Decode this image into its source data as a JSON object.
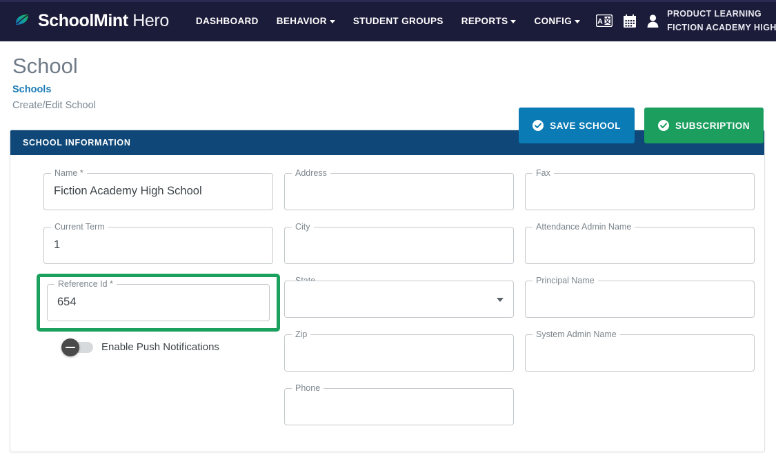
{
  "nav": {
    "brand_bold": "SchoolMint",
    "brand_light": "Hero",
    "brand_icon": "leaf-logo-icon",
    "items": [
      {
        "label": "DASHBOARD",
        "has_caret": false,
        "name": "nav-dashboard"
      },
      {
        "label": "BEHAVIOR",
        "has_caret": true,
        "name": "nav-behavior"
      },
      {
        "label": "STUDENT GROUPS",
        "has_caret": false,
        "name": "nav-student-groups"
      },
      {
        "label": "REPORTS",
        "has_caret": true,
        "name": "nav-reports"
      },
      {
        "label": "CONFIG",
        "has_caret": true,
        "name": "nav-config"
      }
    ],
    "icons": [
      {
        "name": "translate-icon"
      },
      {
        "name": "calendar-icon"
      },
      {
        "name": "user-account-icon"
      }
    ],
    "user_line1": "PRODUCT LEARNING",
    "user_line2": "FICTION ACADEMY HIGH S"
  },
  "header": {
    "title": "School",
    "breadcrumb_link": "Schools",
    "breadcrumb_current": "Create/Edit School",
    "save_button": "SAVE SCHOOL",
    "subscription_button": "SUBSCRIPTION",
    "save_button_color": "#0a7bb5",
    "subscription_button_color": "#1b9e5e",
    "check_icon": "check-circle-icon"
  },
  "card": {
    "section_title": "SCHOOL INFORMATION",
    "section_color": "#0e4778",
    "highlight_color": "#1ba05e"
  },
  "form": {
    "columns": [
      {
        "fields": [
          {
            "label": "Name *",
            "value": "Fiction Academy High School",
            "type": "text",
            "name": "name-field",
            "highlight": false
          },
          {
            "label": "Current Term",
            "value": "1",
            "type": "text",
            "name": "current-term-field",
            "highlight": false
          },
          {
            "label": "Reference Id *",
            "value": "654",
            "type": "text",
            "name": "reference-id-field",
            "highlight": true
          }
        ],
        "toggle": {
          "label": "Enable Push Notifications",
          "state": "off",
          "name": "enable-push-notifications-toggle"
        }
      },
      {
        "fields": [
          {
            "label": "Address",
            "value": "",
            "type": "text",
            "name": "address-field",
            "highlight": false
          },
          {
            "label": "City",
            "value": "",
            "type": "text",
            "name": "city-field",
            "highlight": false
          },
          {
            "label": "State",
            "value": "",
            "type": "select",
            "name": "state-select",
            "highlight": false
          },
          {
            "label": "Zip",
            "value": "",
            "type": "text",
            "name": "zip-field",
            "highlight": false
          },
          {
            "label": "Phone",
            "value": "",
            "type": "text",
            "name": "phone-field",
            "highlight": false
          }
        ]
      },
      {
        "fields": [
          {
            "label": "Fax",
            "value": "",
            "type": "text",
            "name": "fax-field",
            "highlight": false
          },
          {
            "label": "Attendance Admin Name",
            "value": "",
            "type": "text",
            "name": "attendance-admin-name-field",
            "highlight": false
          },
          {
            "label": "Principal Name",
            "value": "",
            "type": "text",
            "name": "principal-name-field",
            "highlight": false
          },
          {
            "label": "System Admin Name",
            "value": "",
            "type": "text",
            "name": "system-admin-name-field",
            "highlight": false
          }
        ]
      }
    ]
  }
}
